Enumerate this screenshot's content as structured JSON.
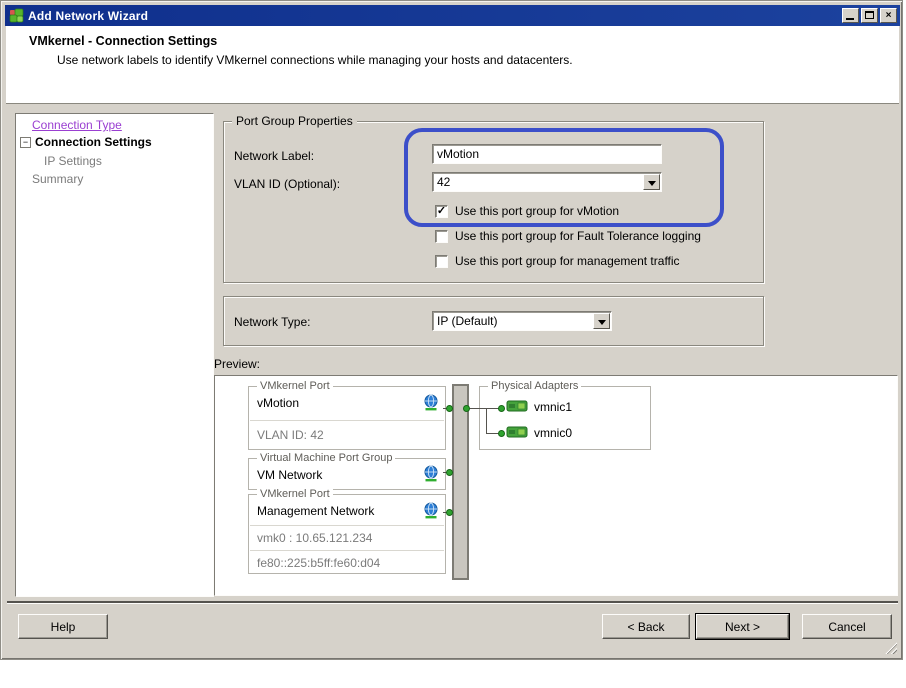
{
  "window": {
    "title": "Add Network Wizard",
    "close_glyph": "×"
  },
  "header": {
    "title": "VMkernel - Connection Settings",
    "description": "Use network labels to identify VMkernel connections while managing your hosts and datacenters."
  },
  "sidebar": {
    "expander_glyph": "−",
    "items": [
      {
        "label": "Connection Type",
        "state": "visited-link"
      },
      {
        "label": "Connection Settings",
        "state": "current"
      },
      {
        "label": "IP Settings",
        "state": "disabled"
      },
      {
        "label": "Summary",
        "state": "disabled"
      }
    ]
  },
  "port_group_properties": {
    "title": "Port Group Properties",
    "network_label": {
      "label": "Network Label:",
      "value": "vMotion"
    },
    "vlan_id": {
      "label": "VLAN ID (Optional):",
      "value": "42"
    },
    "checkboxes": [
      {
        "label": "Use this port group for vMotion",
        "checked": true,
        "mark": "✓"
      },
      {
        "label": "Use this port group for Fault Tolerance logging",
        "checked": false,
        "mark": ""
      },
      {
        "label": "Use this port group for management traffic",
        "checked": false,
        "mark": ""
      }
    ]
  },
  "network_type": {
    "label": "Network Type:",
    "value": "IP (Default)"
  },
  "preview": {
    "label": "Preview:",
    "groups": [
      {
        "type": "VMkernel Port",
        "name": "vMotion",
        "detail1": "VLAN ID: 42"
      },
      {
        "type": "Virtual Machine Port Group",
        "name": "VM Network"
      },
      {
        "type": "VMkernel Port",
        "name": "Management Network",
        "detail1": "vmk0 : 10.65.121.234",
        "detail2": "fe80::225:b5ff:fe60:d04"
      }
    ],
    "physical_adapters": {
      "title": "Physical Adapters",
      "items": [
        "vmnic1",
        "vmnic0"
      ]
    }
  },
  "buttons": {
    "help": "Help",
    "back": "< Back",
    "next": "Next >",
    "cancel": "Cancel"
  },
  "colors": {
    "titlebar": "#0f2f8c",
    "dialog_bg": "#d6d2ca",
    "annotation_blue": "#3c4fc9",
    "visited_link_purple": "#9a3fd1",
    "disabled_text": "#7b7b7b",
    "connector_green": "#2fa32f"
  }
}
